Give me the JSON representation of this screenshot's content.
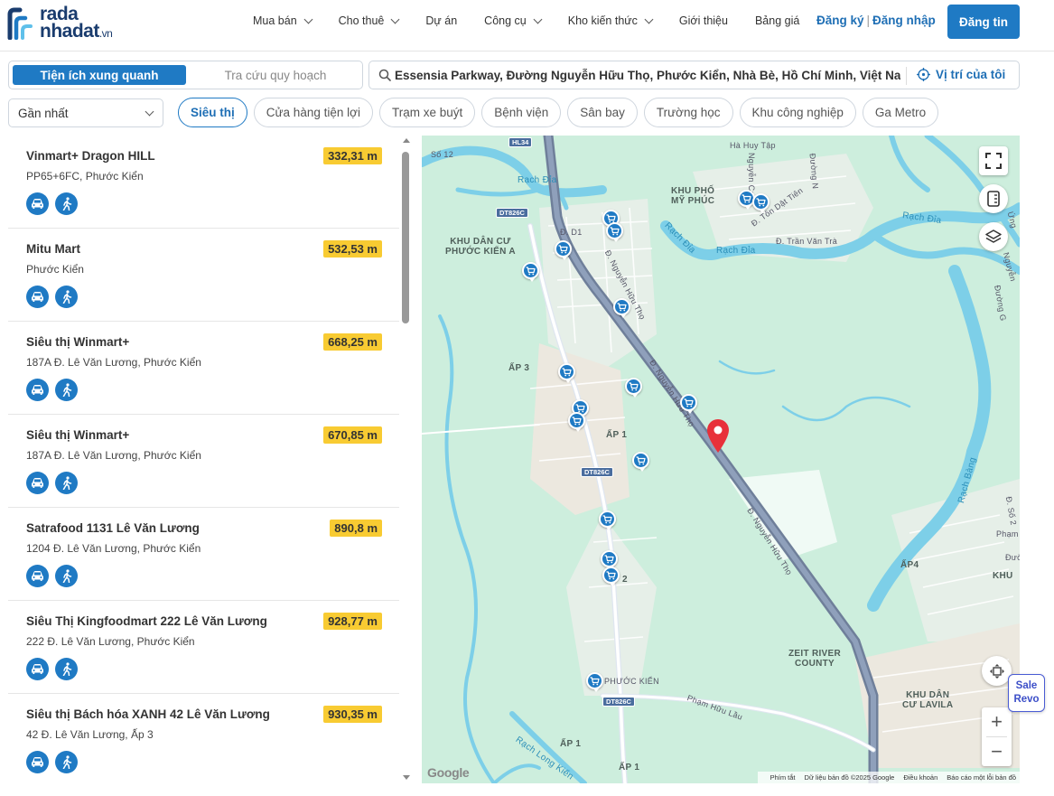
{
  "brand": {
    "line1": "rada",
    "line2": "nhadat",
    "suffix": ".vn",
    "color": "#1a3c6e"
  },
  "nav": [
    {
      "label": "Mua bán",
      "dropdown": true
    },
    {
      "label": "Cho thuê",
      "dropdown": true
    },
    {
      "label": "Dự án",
      "dropdown": false
    },
    {
      "label": "Công cụ",
      "dropdown": true
    },
    {
      "label": "Kho kiến thức",
      "dropdown": true
    },
    {
      "label": "Giới thiệu",
      "dropdown": false
    },
    {
      "label": "Bảng giá",
      "dropdown": false
    }
  ],
  "auth": {
    "register": "Đăng ký",
    "separator": "|",
    "login": "Đăng nhập"
  },
  "post_button": "Đăng tin",
  "tabs": {
    "active": "Tiện ích xung quanh",
    "inactive": "Tra cứu quy hoạch"
  },
  "search": {
    "value": "Essensia Parkway, Đường Nguyễn Hữu Thọ, Phước Kiển, Nhà Bè, Hồ Chí Minh, Việt Nam",
    "locate_label": "Vị trí của tôi"
  },
  "sort": {
    "selected": "Gần nhất"
  },
  "categories": [
    {
      "label": "Siêu thị",
      "active": true
    },
    {
      "label": "Cửa hàng tiện lợi",
      "active": false
    },
    {
      "label": "Trạm xe buýt",
      "active": false
    },
    {
      "label": "Bệnh viện",
      "active": false
    },
    {
      "label": "Sân bay",
      "active": false
    },
    {
      "label": "Trường học",
      "active": false
    },
    {
      "label": "Khu công nghiệp",
      "active": false
    },
    {
      "label": "Ga Metro",
      "active": false
    }
  ],
  "places": [
    {
      "name": "Vinmart+ Dragon HILL",
      "address": "PP65+6FC, Phước Kiển",
      "distance": "332,31 m"
    },
    {
      "name": "Mitu Mart",
      "address": "Phước Kiển",
      "distance": "532,53 m"
    },
    {
      "name": "Siêu thị Winmart+",
      "address": "187A Đ. Lê Văn Lương, Phước Kiển",
      "distance": "668,25 m"
    },
    {
      "name": "Siêu thị Winmart+",
      "address": "187A Đ. Lê Văn Lương, Phước Kiển",
      "distance": "670,85 m"
    },
    {
      "name": "Satrafood 1131 Lê Văn Lương",
      "address": "1204 Đ. Lê Văn Lương, Phước Kiển",
      "distance": "890,8 m"
    },
    {
      "name": "Siêu Thị Kingfoodmart 222 Lê Văn Lương",
      "address": "222 Đ. Lê Văn Lương, Phước Kiển",
      "distance": "928,77 m"
    },
    {
      "name": "Siêu thị Bách hóa XANH 42 Lê Văn Lương",
      "address": "42 Đ. Lê Văn Lương, Ấp 3",
      "distance": "930,35 m"
    }
  ],
  "map": {
    "labels": {
      "khu_pho_my_phuc": "KHU PHỐ\nMỸ PHÚC",
      "khu_dan_cu_pka": "KHU DÂN CƯ\nPHƯỚC KIỂN A",
      "ap3": "ẤP 3",
      "ap1": "ẤP 1",
      "ap1b": "ẤP 1",
      "ap1c": "ẤP 1",
      "ap4": "ẤP4",
      "num2": "2",
      "zeit": "ZEIT RIVER\nCOUNTY",
      "lavila": "KHU DÂN\nCƯ LAVILA",
      "phuoc_kien": "PHƯỚC KIỂN",
      "so12": "Số 12",
      "d_d1": "Đ. D1",
      "ha_huy_tap": "Hà Huy Tập",
      "nguyen_cao": "Nguyễn Cao",
      "duong_n": "Đường N",
      "ton_dat_tien": "Đ. Tôn Dật Tiên",
      "tran_van_tra": "Đ. Trần Văn Trà",
      "nht1": "Đ. Nguyễn Hữu Thọ",
      "nht2": "Đ. Nguyễn Hữu Thọ",
      "nht3": "Đ. Nguyễn Hữu Thọ",
      "pham_huu_lau": "Phạm Hữu Lầu",
      "rach_dia1": "Rạch Đỉa",
      "rach_dia2": "Rạch Đỉa",
      "rach_dia3": "Rạch Đỉa",
      "rach_dia4": "Rạch Đỉa",
      "rach_bang": "Rạch Bàng",
      "rach_long_kieng": "Rạch Long Kiến",
      "duong_g": "Đường G",
      "nguyen_r": "Nguyễn",
      "ung_r": "Ứng",
      "pham_r": "Phạm",
      "khu_r": "KHU",
      "dso2": "Đ. Số 2",
      "duong_r": "Đườ"
    },
    "shields": {
      "hl34": "HL34",
      "dt826c_1": "DT826C",
      "dt826c_2": "DT826C",
      "dt826c_3": "DT826C"
    },
    "google": "Google",
    "attribution": [
      "Phím tắt",
      "Dữ liệu bản đồ ©2025 Google",
      "Điều khoản",
      "Báo cáo một lỗi bản đồ"
    ],
    "zoom_in": "+",
    "zoom_out": "−"
  },
  "sale_badge": {
    "line1": "Sale",
    "line2": "Revo"
  },
  "colors": {
    "primary": "#1f7ac4",
    "distance_badge": "#f8cb32",
    "pin": "#e8303a",
    "water": "#7dcfe8",
    "land": "#cdeedd"
  }
}
